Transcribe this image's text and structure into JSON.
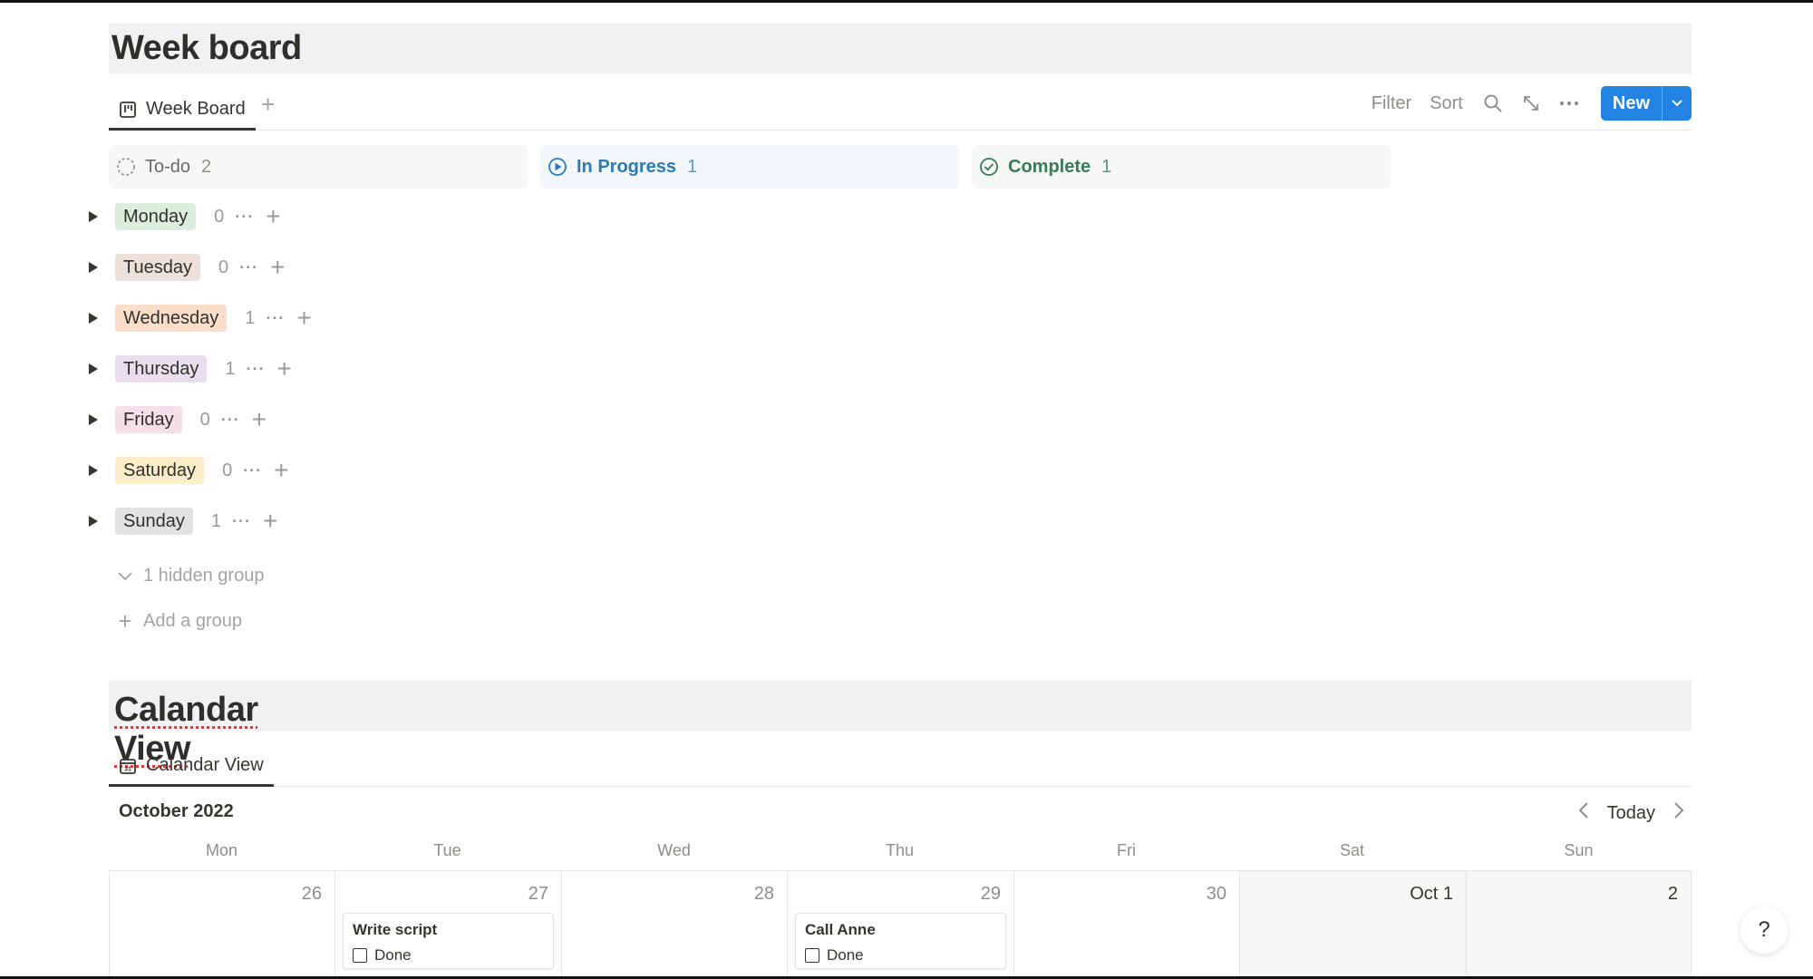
{
  "week_board": {
    "title": "Week board",
    "tab_label": "Week Board",
    "toolbar": {
      "filter": "Filter",
      "sort": "Sort",
      "new": "New"
    },
    "columns": [
      {
        "label": "To-do",
        "count": "2",
        "color": "#6b6a66",
        "bg": "#f7f7f5"
      },
      {
        "label": "In Progress",
        "count": "1",
        "color": "#2b7bb9",
        "bg": "#f2f7fb"
      },
      {
        "label": "Complete",
        "count": "1",
        "color": "#3a7a55",
        "bg": "#f5f8f4"
      }
    ],
    "groups": [
      {
        "label": "Monday",
        "count": "0",
        "bg": "#dbeddb"
      },
      {
        "label": "Tuesday",
        "count": "0",
        "bg": "#eee0da"
      },
      {
        "label": "Wednesday",
        "count": "1",
        "bg": "#fadec9"
      },
      {
        "label": "Thursday",
        "count": "1",
        "bg": "#e8deee"
      },
      {
        "label": "Friday",
        "count": "0",
        "bg": "#f5e0e9"
      },
      {
        "label": "Saturday",
        "count": "0",
        "bg": "#fdecc8"
      },
      {
        "label": "Sunday",
        "count": "1",
        "bg": "#e3e2e0"
      }
    ],
    "hidden_group": "1 hidden group",
    "add_group": "Add a group"
  },
  "calendar": {
    "title": "Calandar View",
    "tab_label": "Calandar View",
    "month": "October 2022",
    "today": "Today",
    "weekdays": [
      "Mon",
      "Tue",
      "Wed",
      "Thu",
      "Fri",
      "Sat",
      "Sun"
    ],
    "days": [
      "26",
      "27",
      "28",
      "29",
      "30",
      "Oct 1",
      "2"
    ],
    "cards": [
      {
        "day": "27",
        "title": "Write script",
        "check_label": "Done"
      },
      {
        "day": "29",
        "title": "Call Anne",
        "check_label": "Done"
      }
    ]
  },
  "help": "?"
}
